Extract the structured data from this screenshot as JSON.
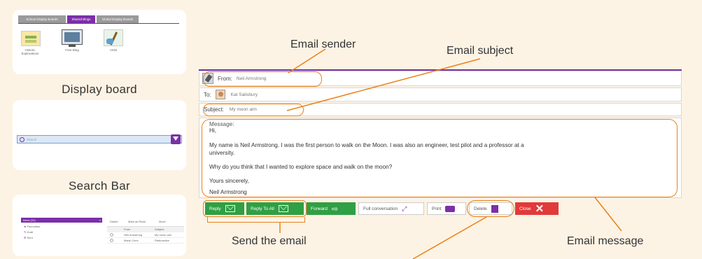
{
  "display_board": {
    "tabs": [
      "School Display Boards",
      "Shared Blogs",
      "Global Display Boards"
    ],
    "tiles": [
      "Historic Explorations",
      "Free Blog",
      "Artist"
    ],
    "caption": "Display board"
  },
  "search_bar": {
    "placeholder": "Search",
    "caption": "Search Bar"
  },
  "inbox_panel": {
    "folders": [
      "Inbox (11)",
      "Favourites",
      "Draft",
      "Sent"
    ],
    "toolbar": [
      "Delete",
      "Mark as Read",
      "Move"
    ],
    "columns": [
      "From",
      "Subject"
    ],
    "rows": [
      {
        "from": "Neil Armstrong",
        "subject": "My moon aim"
      },
      {
        "from": "Marie Curie",
        "subject": "Radioactive"
      }
    ]
  },
  "email": {
    "from_label": "From:",
    "from_value": "Neil Armstrong",
    "to_label": "To:",
    "to_value": "Kat Salisbury",
    "subject_label": "Subject:",
    "subject_value": "My moon aim",
    "message_label": "Message:",
    "message_lines": [
      "Hi,",
      "My name is Neil Armstrong. I was the first person to walk on the Moon. I was also an engineer, test pilot and a professor at a",
      "university.",
      "Why do you think that I wanted to explore space and walk on the moon?",
      "Yours sincerely,",
      "Neil Armstrong"
    ]
  },
  "buttons": {
    "reply": "Reply",
    "reply_all": "Reply To All",
    "forward": "Forward",
    "full_conversation": "Full conversation",
    "print": "Print",
    "delete": "Delete",
    "close": "Close"
  },
  "annotations": {
    "sender": "Email sender",
    "subject": "Email subject",
    "send": "Send the email",
    "message": "Email message"
  },
  "colors": {
    "background": "#fdf3e4",
    "accent_purple": "#7c2fa8",
    "annotation_orange": "#e8821a",
    "button_green": "#2fa043",
    "button_red": "#e23a3a",
    "heading_blue": "#1f5fbf"
  }
}
